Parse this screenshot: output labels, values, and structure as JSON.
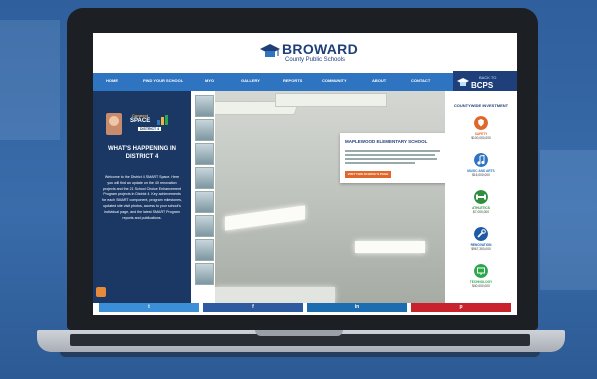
{
  "header": {
    "logo_small": "Connect",
    "brand": "BROWARD",
    "brand_sub": "County Public Schools"
  },
  "nav": {
    "items": [
      "HOME",
      "FIND YOUR SCHOOL",
      "MYO",
      "GALLERY",
      "REPORTS",
      "COMMUNITY",
      "ABOUT",
      "CONTACT"
    ],
    "back_small": "BACK TO",
    "back_big": "BCPS HOME"
  },
  "left": {
    "badge_top": "Connect",
    "badge_main": "SPACE",
    "badge_district": "DISTRICT 4",
    "heading": "WHAT'S HAPPENING IN DISTRICT 4",
    "body": "Welcome to the District 4 SMART Space. Here you will find an update on the 40 renovation projects and the 21 School Choice Enhancement Program projects in District 4. Key achievements for each SMART component, program milestones, updated site visit photos, access to your school's individual page, and the latest SMART Program reports and publications."
  },
  "card": {
    "title": "MAPLEWOOD ELEMENTARY SCHOOL",
    "button": "VISIT THIS SCHOOL'S PAGE"
  },
  "investment": {
    "heading": "CountyWide Investment",
    "items": [
      {
        "label": "SAFETY",
        "amount": "$100,000,000",
        "color": "#e0672b",
        "icon": "shield-icon"
      },
      {
        "label": "MUSIC AND ARTS",
        "amount": "$15,000,000",
        "color": "#2e74c0",
        "icon": "music-icon"
      },
      {
        "label": "ATHLETICS",
        "amount": "$7,000,000",
        "color": "#2f8f3e",
        "icon": "athletics-icon"
      },
      {
        "label": "RENOVATION",
        "amount": "$967,300,000",
        "color": "#1f5aa5",
        "icon": "wrench-icon"
      },
      {
        "label": "TECHNOLOGY",
        "amount": "$40,000,000",
        "color": "#2aa84a",
        "icon": "monitor-icon"
      }
    ]
  },
  "share": {
    "twitter": "t",
    "facebook": "f",
    "linkedin": "in",
    "pinterest": "p",
    "colors": [
      "#3a8fd6",
      "#2e5aa0",
      "#1b6db0",
      "#c8232c"
    ]
  }
}
